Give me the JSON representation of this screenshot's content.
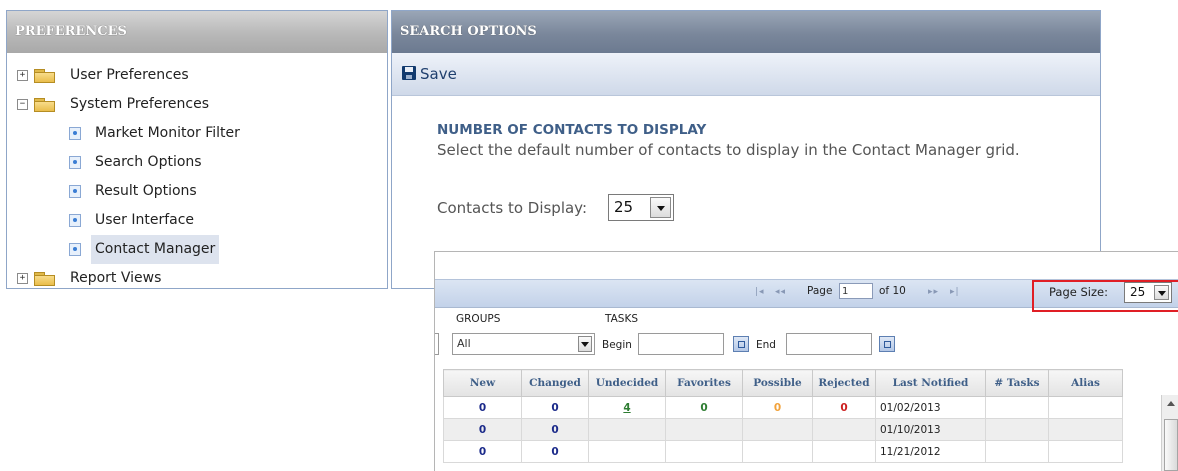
{
  "preferences": {
    "title": "PREFERENCES",
    "tree": [
      {
        "label": "User Preferences",
        "expander": "+"
      },
      {
        "label": "System Preferences",
        "expander": "−"
      },
      {
        "label": "Market Monitor Filter"
      },
      {
        "label": "Search Options"
      },
      {
        "label": "Result Options"
      },
      {
        "label": "User Interface"
      },
      {
        "label": "Contact Manager"
      },
      {
        "label": "Report Views",
        "expander": "+"
      }
    ]
  },
  "search_options": {
    "title": "SEARCH OPTIONS",
    "save_label": "Save",
    "section_title": "NUMBER OF CONTACTS TO DISPLAY",
    "section_desc": "Select the default number of contacts to display in the Contact Manager grid.",
    "contacts_label": "Contacts to Display:",
    "contacts_value": "25"
  },
  "grid": {
    "pager": {
      "first": "|◂",
      "prev": "◂◂",
      "page_label": "Page",
      "page_value": "1",
      "of_label": "of 10",
      "next": "▸▸",
      "last": "▸|",
      "page_size_label": "Page Size:",
      "page_size_value": "25"
    },
    "filters": {
      "groups_label": "GROUPS",
      "tasks_label": "TASKS",
      "groups_value": "All",
      "begin_label": "Begin",
      "end_label": "End"
    },
    "columns": [
      "New",
      "Changed",
      "Undecided",
      "Favorites",
      "Possible",
      "Rejected",
      "Last Notified",
      "# Tasks",
      "Alias"
    ],
    "rows": [
      {
        "new": "0",
        "changed": "0",
        "undecided": "4",
        "favorites": "0",
        "possible": "0",
        "rejected": "0",
        "last_notified": "01/02/2013",
        "tasks": "",
        "alias": ""
      },
      {
        "new": "0",
        "changed": "0",
        "undecided": "",
        "favorites": "",
        "possible": "",
        "rejected": "",
        "last_notified": "01/10/2013",
        "tasks": "",
        "alias": ""
      },
      {
        "new": "0",
        "changed": "0",
        "undecided": "",
        "favorites": "",
        "possible": "",
        "rejected": "",
        "last_notified": "11/21/2012",
        "tasks": "",
        "alias": ""
      }
    ]
  },
  "colors": {
    "header_blue": "#3f5f88",
    "count_blue": "#1b2a8a",
    "count_green": "#2e7d32",
    "count_orange": "#f2a23a",
    "count_red": "#cc1f1f",
    "highlight_red": "#e01e25"
  },
  "icons": [
    "folder-icon",
    "expand-icon",
    "collapse-icon",
    "page-icon",
    "save-disk-icon",
    "dropdown-arrow-icon",
    "calendar-icon"
  ]
}
